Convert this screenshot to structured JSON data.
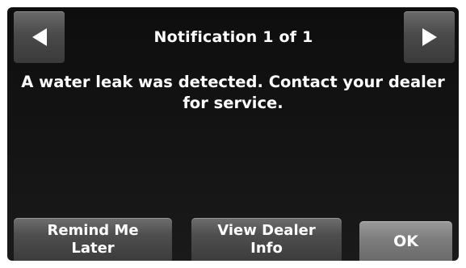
{
  "header": {
    "title": "Notification 1 of 1",
    "prev_icon": "left-arrow-icon",
    "next_icon": "right-arrow-icon"
  },
  "message": "A water leak was detected. Contact your dealer\nfor service.",
  "actions": {
    "remind_label": "Remind Me\nLater",
    "dealer_label": "View Dealer\nInfo",
    "ok_label": "OK"
  },
  "colors": {
    "background": "#141414",
    "button": "#4e4e4e",
    "ok_button": "#7e7e7e",
    "text": "#ffffff"
  }
}
